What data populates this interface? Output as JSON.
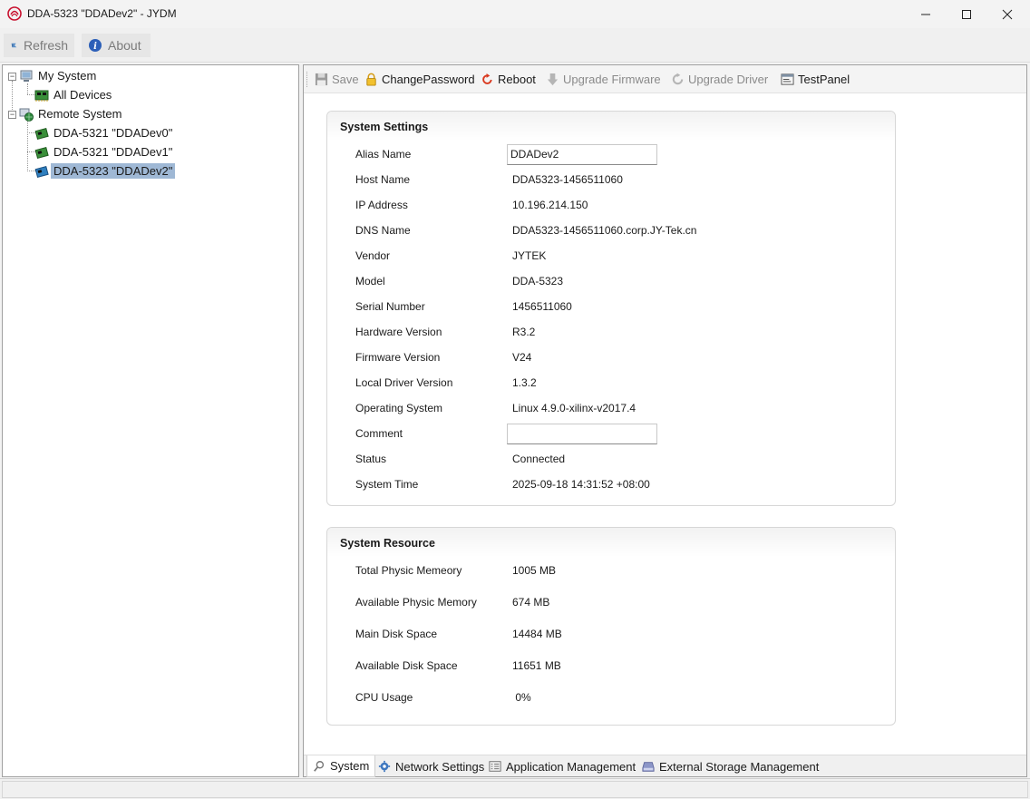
{
  "window": {
    "title": "DDA-5323 \"DDADev2\" - JYDM",
    "accent": "#c8102e"
  },
  "toolbar": {
    "refresh_label": "Refresh",
    "about_label": "About"
  },
  "tree": {
    "my_system": "My System",
    "all_devices": "All Devices",
    "remote_system": "Remote System",
    "devices": [
      {
        "label": "DDA-5321 \"DDADev0\""
      },
      {
        "label": "DDA-5321 \"DDADev1\""
      },
      {
        "label": "DDA-5323 \"DDADev2\""
      }
    ],
    "selected_color": "#9fb8d5"
  },
  "subtoolbar": {
    "save": "Save",
    "change_password": "ChangePassword",
    "reboot": "Reboot",
    "upgrade_firmware": "Upgrade Firmware",
    "upgrade_driver": "Upgrade Driver",
    "test_panel": "TestPanel"
  },
  "system_settings": {
    "title": "System Settings",
    "alias_name": {
      "label": "Alias Name",
      "value": "DDADev2"
    },
    "host_name": {
      "label": "Host Name",
      "value": "DDA5323-1456511060"
    },
    "ip_address": {
      "label": "IP Address",
      "value": "10.196.214.150"
    },
    "dns_name": {
      "label": "DNS Name",
      "value": "DDA5323-1456511060.corp.JY-Tek.cn"
    },
    "vendor": {
      "label": "Vendor",
      "value": "JYTEK"
    },
    "model": {
      "label": "Model",
      "value": "DDA-5323"
    },
    "serial_number": {
      "label": "Serial Number",
      "value": "1456511060"
    },
    "hardware_version": {
      "label": "Hardware Version",
      "value": "R3.2"
    },
    "firmware_version": {
      "label": "Firmware Version",
      "value": "V24"
    },
    "local_driver_version": {
      "label": "Local Driver Version",
      "value": "1.3.2"
    },
    "operating_system": {
      "label": "Operating System",
      "value": "Linux 4.9.0-xilinx-v2017.4"
    },
    "comment": {
      "label": "Comment",
      "value": ""
    },
    "status": {
      "label": "Status",
      "value": "Connected"
    },
    "system_time": {
      "label": "System Time",
      "value": "2025-09-18 14:31:52 +08:00"
    }
  },
  "system_resource": {
    "title": "System Resource",
    "total_memory": {
      "label": "Total Physic Memeory",
      "value": "1005 MB"
    },
    "available_memory": {
      "label": "Available Physic Memory",
      "value": "674 MB"
    },
    "main_disk": {
      "label": "Main Disk Space",
      "value": "14484 MB"
    },
    "available_disk": {
      "label": "Available Disk Space",
      "value": "11651 MB"
    },
    "cpu_usage": {
      "label": "CPU Usage",
      "value": " 0%"
    }
  },
  "tabs": {
    "system": "System",
    "network_settings": "Network Settings",
    "application_management": "Application Management",
    "external_storage_management": "External Storage Management"
  }
}
